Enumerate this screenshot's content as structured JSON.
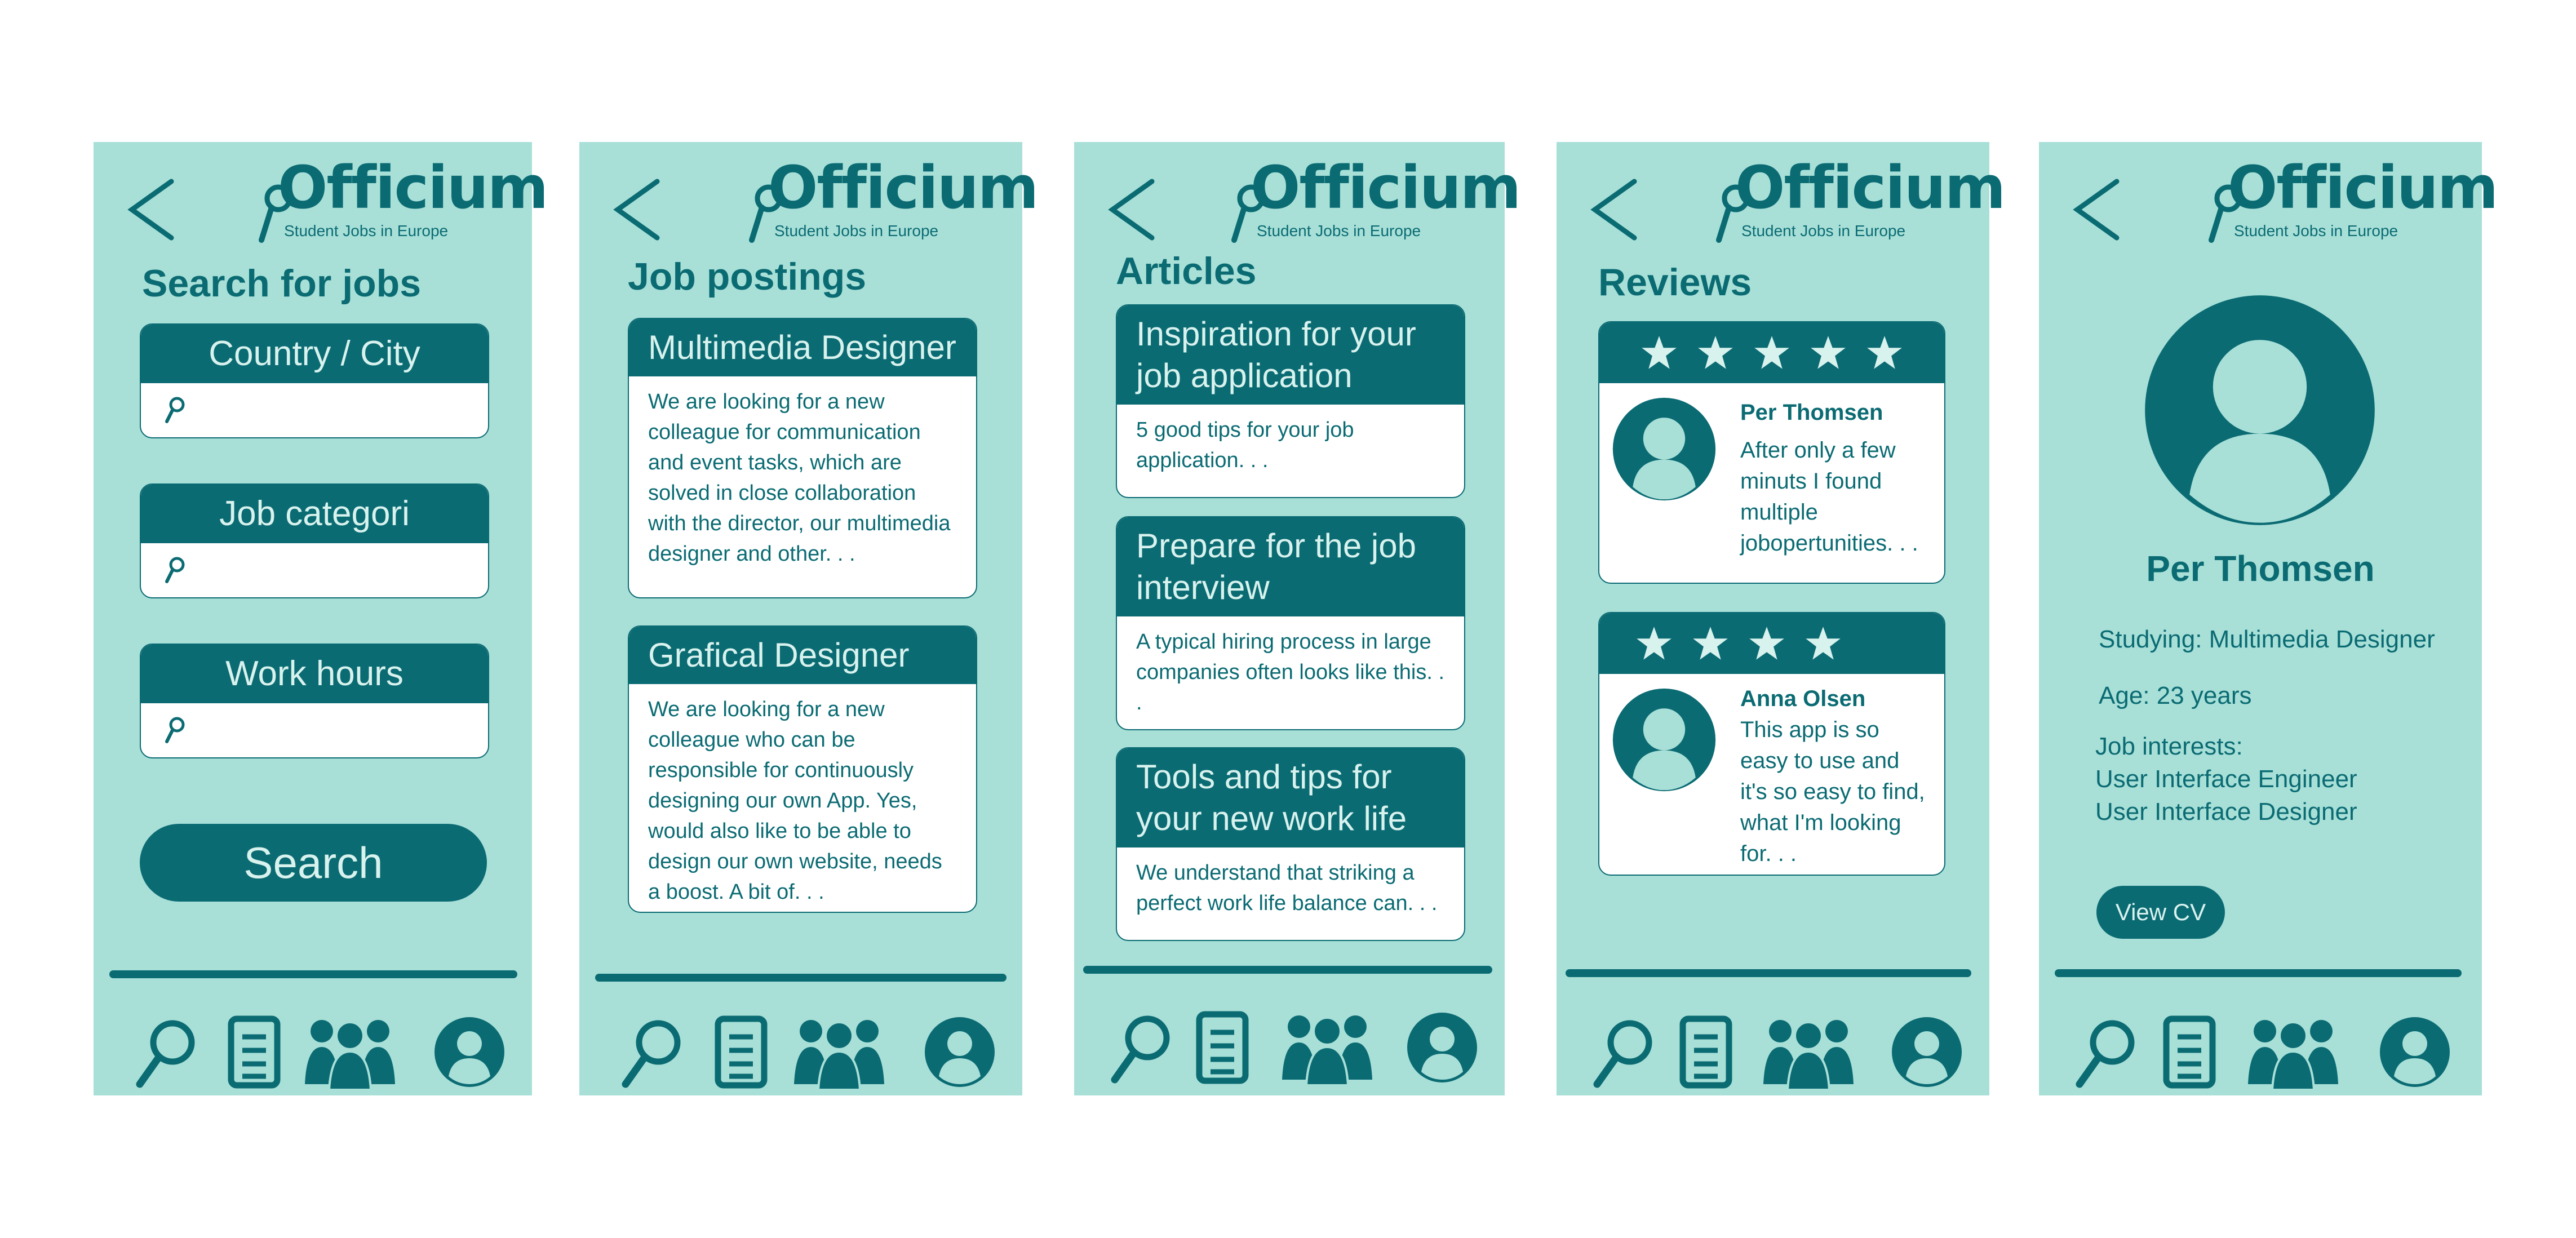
{
  "brand": {
    "name": "Officium",
    "tagline": "Student Jobs in Europe",
    "colors": {
      "primary": "#0b6b73",
      "background": "#a8e0d8",
      "light_text": "#d8f2ee"
    }
  },
  "nav": {
    "icons": [
      "search-icon",
      "document-icon",
      "people-icon",
      "profile-icon"
    ]
  },
  "screen1": {
    "title": "Search for jobs",
    "fields": [
      {
        "label": "Country / City",
        "value": ""
      },
      {
        "label": "Job categori",
        "value": ""
      },
      {
        "label": "Work hours",
        "value": ""
      }
    ],
    "button": "Search"
  },
  "screen2": {
    "title": "Job postings",
    "postings": [
      {
        "title": "Multimedia Designer",
        "text": "We are looking for a new colleague for communication and event tasks, which are solved in close collaboration with the director, our multimedia designer and other. . ."
      },
      {
        "title": "Grafical Designer",
        "text": "We are looking for a new colleague who can be responsible for continuously designing our own App. Yes, would also like to be able to design our own website, needs a boost. A bit of. . ."
      }
    ]
  },
  "screen3": {
    "title": "Articles",
    "articles": [
      {
        "title": "Inspiration for your job application",
        "text": "5 good tips for your job application. . ."
      },
      {
        "title": "Prepare for the job interview",
        "text": "A typical hiring process in large companies often looks like this. . ."
      },
      {
        "title": "Tools and tips for your new work life",
        "text": "We understand that striking a perfect work life balance can. . ."
      }
    ]
  },
  "screen4": {
    "title": "Reviews",
    "reviews": [
      {
        "stars": 5,
        "name": "Per Thomsen",
        "text": "After only a few minuts I found multiple jobopertunities. . ."
      },
      {
        "stars": 4,
        "name": "Anna Olsen",
        "text": "This app is so easy to use and it's so easy to find, what I'm looking for. . ."
      }
    ]
  },
  "screen5": {
    "name": "Per Thomsen",
    "studying": "Studying: Multimedia Designer",
    "age": "Age: 23 years",
    "interests_label": "Job interests:",
    "interests": [
      "User Interface Engineer",
      "User Interface Designer"
    ],
    "button": "View CV"
  }
}
